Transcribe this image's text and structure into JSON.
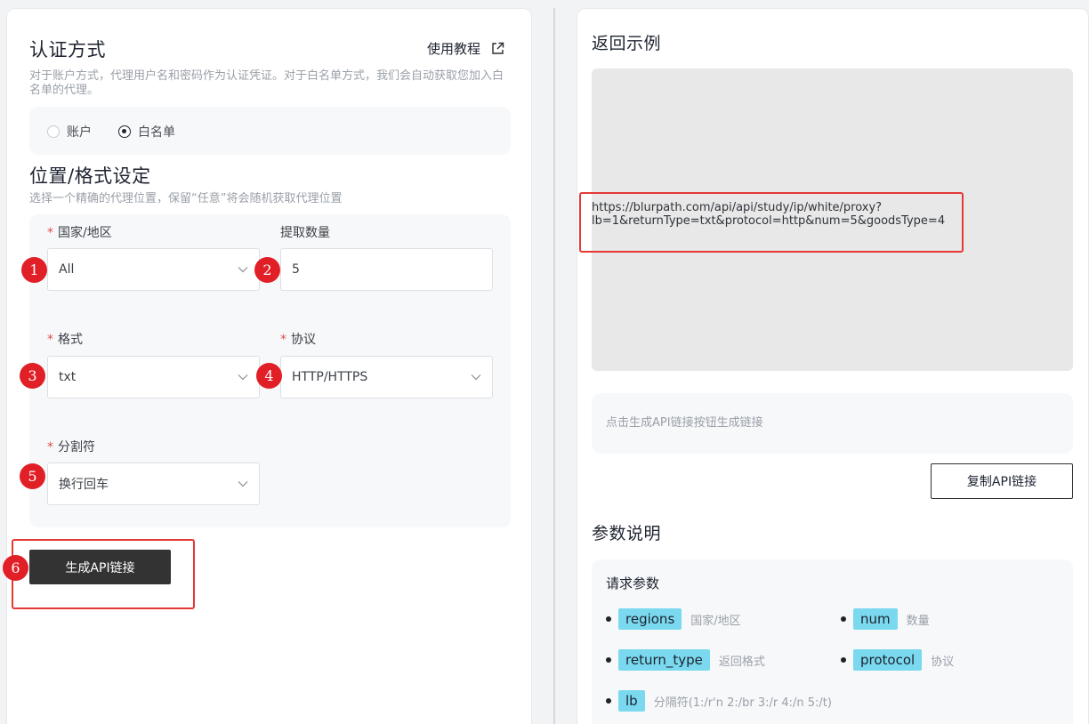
{
  "auth": {
    "title": "认证方式",
    "tutorial_label": "使用教程",
    "description": "对于账户方式，代理用户名和密码作为认证凭证。对于白名单方式，我们会自动获取您加入白名单的代理。",
    "options": [
      {
        "label": "账户",
        "checked": false
      },
      {
        "label": "白名单",
        "checked": true
      }
    ]
  },
  "location": {
    "title": "位置/格式设定",
    "description": "选择一个精确的代理位置，保留“任意”将会随机获取代理位置",
    "fields": {
      "region": {
        "label": "国家/地区",
        "required": true,
        "value": "All"
      },
      "quantity": {
        "label": "提取数量",
        "required": false,
        "value": "5"
      },
      "format": {
        "label": "格式",
        "required": true,
        "value": "txt"
      },
      "protocol": {
        "label": "协议",
        "required": true,
        "value": "HTTP/HTTPS"
      },
      "separator": {
        "label": "分割符",
        "required": true,
        "value": "换行回车"
      }
    },
    "generate_label": "生成API链接"
  },
  "badges": [
    "1",
    "2",
    "3",
    "4",
    "5",
    "6"
  ],
  "example": {
    "title": "返回示例",
    "url_line1": "https://blurpath.com/api/api/study/ip/white/proxy?",
    "url_line2": "lb=1&returnType=txt&protocol=http&num=5&goodsType=4",
    "hint": "点击生成API链接按钮生成链接",
    "copy_label": "复制API链接"
  },
  "params": {
    "title": "参数说明",
    "subtitle": "请求参数",
    "items": [
      {
        "key": "regions",
        "desc": "国家/地区"
      },
      {
        "key": "num",
        "desc": "数量"
      },
      {
        "key": "return_type",
        "desc": "返回格式"
      },
      {
        "key": "protocol",
        "desc": "协议"
      },
      {
        "key": "lb",
        "desc": "分隔符(1:/r'n 2:/br 3:/r 4:/n 5:/t)"
      }
    ]
  },
  "colors": {
    "accent_chip": "#7ad9ee",
    "badge_red": "#e11f26",
    "highlight_red": "#e53935",
    "dark_button": "#333333"
  }
}
